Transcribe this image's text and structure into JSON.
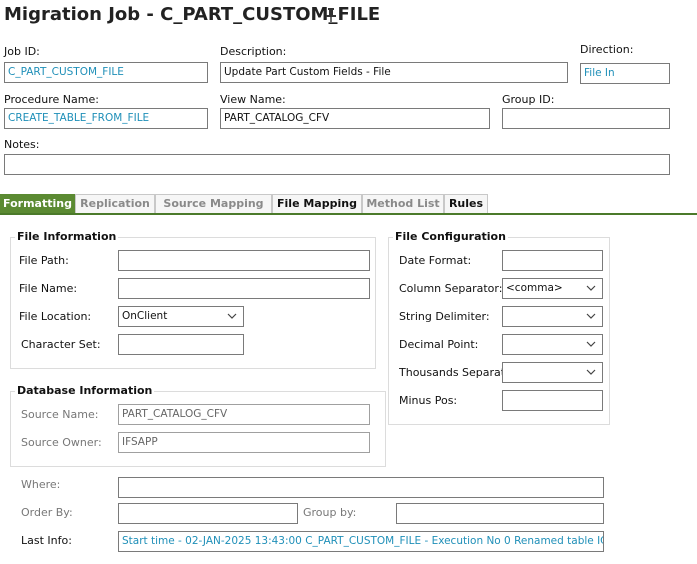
{
  "header": {
    "title": "Migration Job - C_PART_CUSTOM_FILE",
    "pin_icon": "pin-icon"
  },
  "form": {
    "job_id": {
      "label": "Job ID:",
      "value": "C_PART_CUSTOM_FILE"
    },
    "description": {
      "label": "Description:",
      "value": "Update Part Custom Fields - File"
    },
    "direction": {
      "label": "Direction:",
      "value": "File In"
    },
    "procedure_name": {
      "label": "Procedure Name:",
      "value": "CREATE_TABLE_FROM_FILE"
    },
    "view_name": {
      "label": "View Name:",
      "value": "PART_CATALOG_CFV"
    },
    "group_id": {
      "label": "Group ID:",
      "value": ""
    },
    "notes": {
      "label": "Notes:",
      "value": ""
    }
  },
  "tabs": [
    {
      "label": "Formatting",
      "active": true
    },
    {
      "label": "Replication"
    },
    {
      "label": "Source Mapping"
    },
    {
      "label": "File Mapping"
    },
    {
      "label": "Method List"
    },
    {
      "label": "Rules"
    }
  ],
  "file_information": {
    "title": "File Information",
    "file_path": {
      "label": "File Path:",
      "value": ""
    },
    "file_name": {
      "label": "File Name:",
      "value": ""
    },
    "file_location": {
      "label": "File Location:",
      "value": "OnClient"
    },
    "character_set": {
      "label": "Character Set:",
      "value": ""
    }
  },
  "file_configuration": {
    "title": "File Configuration",
    "date_format": {
      "label": "Date Format:",
      "value": ""
    },
    "column_separator": {
      "label": "Column Separator:",
      "value": "<comma>"
    },
    "string_delimiter": {
      "label": "String Delimiter:",
      "value": ""
    },
    "decimal_point": {
      "label": "Decimal Point:",
      "value": ""
    },
    "thousands_separator": {
      "label": "Thousands Separator:",
      "value": ""
    },
    "minus_pos": {
      "label": "Minus Pos:",
      "value": ""
    }
  },
  "database_information": {
    "title": "Database Information",
    "source_name": {
      "label": "Source Name:",
      "value": "PART_CATALOG_CFV"
    },
    "source_owner": {
      "label": "Source Owner:",
      "value": "IFSAPP"
    }
  },
  "query": {
    "where": {
      "label": "Where:",
      "value": ""
    },
    "order_by": {
      "label": "Order By:",
      "value": ""
    },
    "group_by": {
      "label": "Group by:",
      "value": ""
    },
    "last_info": {
      "label": "Last Info:",
      "value": "Start time - 02-JAN-2025 13:43:00   C_PART_CUSTOM_FILE - Execution No 0 Renamed table IC_C_PART"
    }
  },
  "colors": {
    "accent": "#5b8a32",
    "link": "#1f8fb8"
  }
}
